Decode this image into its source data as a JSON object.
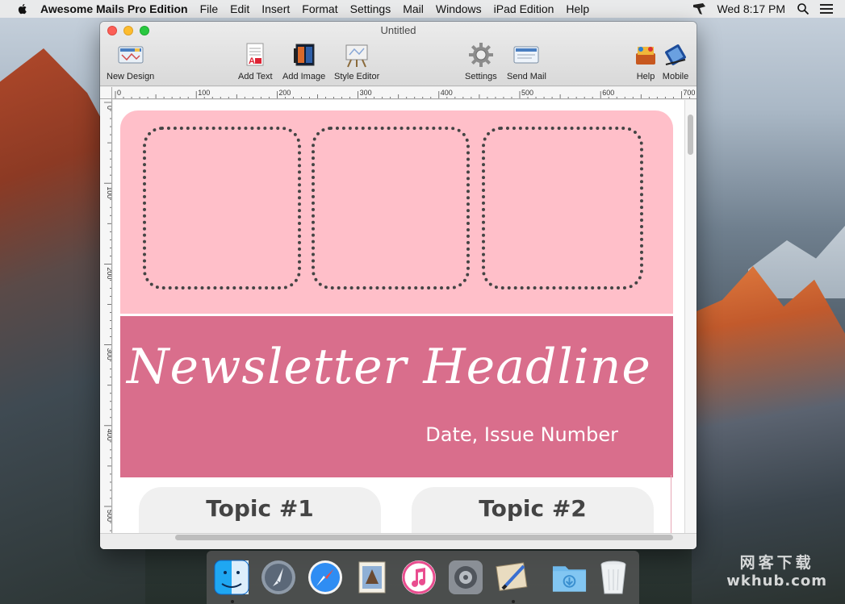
{
  "menubar": {
    "app_name": "Awesome Mails Pro Edition",
    "items": [
      "File",
      "Edit",
      "Insert",
      "Format",
      "Settings",
      "Mail",
      "Windows",
      "iPad Edition",
      "Help"
    ],
    "clock": "Wed 8:17 PM"
  },
  "window": {
    "title": "Untitled",
    "toolbar": {
      "new_design": "New Design",
      "add_text": "Add Text",
      "add_image": "Add Image",
      "style_editor": "Style Editor",
      "settings": "Settings",
      "send_mail": "Send Mail",
      "help": "Help",
      "mobile": "Mobile"
    },
    "ruler_h": [
      "0",
      "100",
      "200",
      "300",
      "400",
      "500",
      "600",
      "700"
    ],
    "ruler_v": [
      "0",
      "100",
      "200",
      "300",
      "400",
      "500"
    ]
  },
  "document": {
    "headline": "Newsletter Headline",
    "dateline": "Date, Issue Number",
    "topic1": "Topic #1",
    "topic2": "Topic #2",
    "colors": {
      "hero_bg": "#ffbfc9",
      "banner_bg": "#d96e8c",
      "topic_bg": "#f0f0f0"
    }
  },
  "dock": {
    "items": [
      "finder-icon",
      "launchpad-icon",
      "safari-icon",
      "mail-icon",
      "itunes-icon",
      "system-preferences-icon",
      "awesome-mails-icon",
      "downloads-folder-icon",
      "trash-icon"
    ]
  },
  "watermark": {
    "zh": "网客下载",
    "en": "wkhub.com"
  }
}
